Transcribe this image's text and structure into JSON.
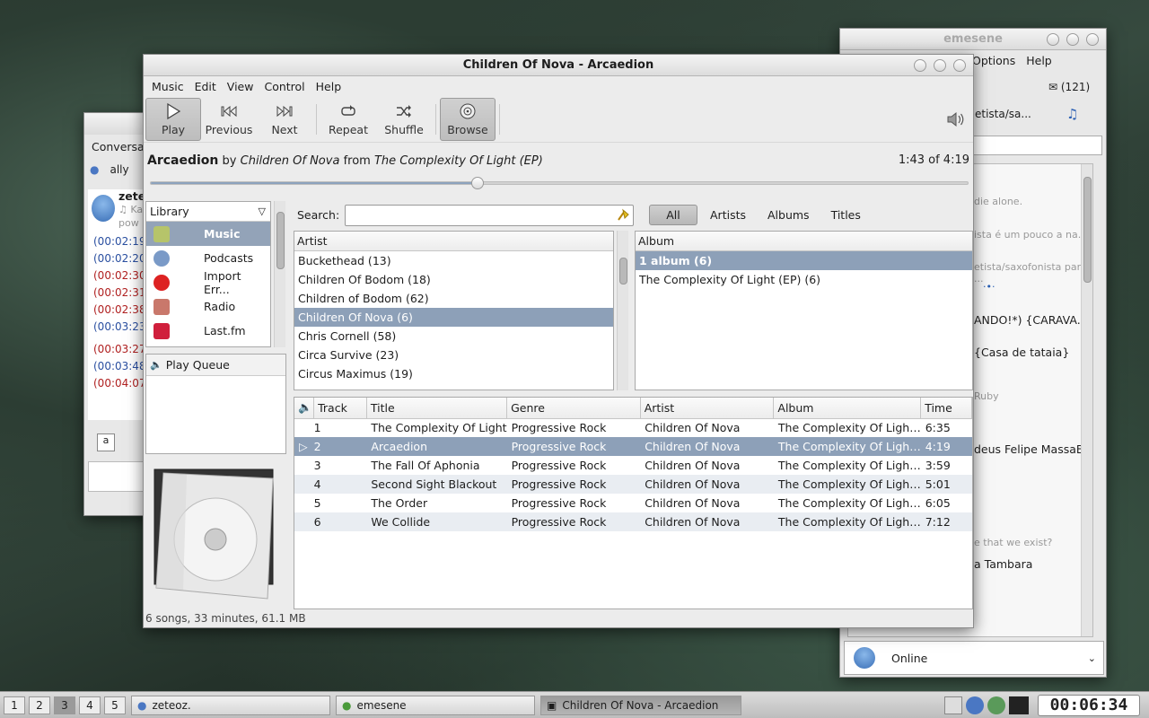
{
  "emesene": {
    "title": "emesene",
    "menu": [
      "Options",
      "Help"
    ],
    "mail_count": "(121)",
    "status": "Online",
    "lines": [
      "die alone.",
      "ista é um pouco a na...",
      "etista/saxofonista para ...",
      "·•·",
      "ANDO!*) {CARAVA...",
      "{Casa de tataia}",
      "Ruby",
      "deus Felipe MassaB",
      "e that we exist?",
      "a Tambara"
    ],
    "head_text": "etista/sa..."
  },
  "conversation": {
    "menu": "Conversa",
    "contact_short": "ally",
    "name": "zete",
    "sub1": "♫ Ka",
    "sub2": "pow",
    "times": [
      "(00:02:19",
      "(00:02:20",
      "(00:02:30",
      "(00:02:31",
      "(00:02:38",
      "(00:03:23",
      "(00:03:27",
      "(00:03:48",
      "(00:04:07"
    ]
  },
  "window": {
    "title": "Children Of Nova - Arcaedion"
  },
  "menu": {
    "music": "Music",
    "edit": "Edit",
    "view": "View",
    "control": "Control",
    "help": "Help"
  },
  "toolbar": {
    "play": "Play",
    "previous": "Previous",
    "next": "Next",
    "repeat": "Repeat",
    "shuffle": "Shuffle",
    "browse": "Browse"
  },
  "now_playing": {
    "track": "Arcaedion",
    "by": "by",
    "artist": "Children Of Nova",
    "from": "from",
    "album": "The Complexity Of Light (EP)",
    "time": "1:43 of 4:19",
    "progress": 0.4
  },
  "library": {
    "header": "Library",
    "items": [
      "Music",
      "Podcasts",
      "Import Err...",
      "Radio",
      "Last.fm"
    ]
  },
  "play_queue": "Play Queue",
  "search": {
    "label": "Search:",
    "value": ""
  },
  "filters": [
    "All",
    "Artists",
    "Albums",
    "Titles"
  ],
  "artist_header": "Artist",
  "artists": [
    "Buckethead (13)",
    "Children Of Bodom (18)",
    "Children of Bodom (62)",
    "Children Of Nova (6)",
    "Chris Cornell (58)",
    "Circa Survive (23)",
    "Circus Maximus (19)"
  ],
  "album_header": "Album",
  "albums": [
    "1 album (6)",
    "The Complexity Of Light (EP) (6)"
  ],
  "tracks": {
    "columns": [
      "Track",
      "Title",
      "Genre",
      "Artist",
      "Album",
      "Time"
    ],
    "rows": [
      [
        "1",
        "The Complexity Of Light",
        "Progressive Rock",
        "Children Of Nova",
        "The Complexity Of Ligh…",
        "6:35"
      ],
      [
        "2",
        "Arcaedion",
        "Progressive Rock",
        "Children Of Nova",
        "The Complexity Of Ligh…",
        "4:19"
      ],
      [
        "3",
        "The Fall Of Aphonia",
        "Progressive Rock",
        "Children Of Nova",
        "The Complexity Of Ligh…",
        "3:59"
      ],
      [
        "4",
        "Second Sight Blackout",
        "Progressive Rock",
        "Children Of Nova",
        "The Complexity Of Ligh…",
        "5:01"
      ],
      [
        "5",
        "The Order",
        "Progressive Rock",
        "Children Of Nova",
        "The Complexity Of Ligh…",
        "6:05"
      ],
      [
        "6",
        "We Collide",
        "Progressive Rock",
        "Children Of Nova",
        "The Complexity Of Ligh…",
        "7:12"
      ]
    ]
  },
  "statusbar": "6 songs, 33 minutes, 61.1 MB",
  "taskbar": {
    "workspaces": [
      "1",
      "2",
      "3",
      "4",
      "5"
    ],
    "tasks": [
      "zeteoz.",
      "emesene",
      "Children Of Nova - Arcaedion"
    ],
    "clock": "00:06:34"
  },
  "colors": {
    "selection": "#8da0b8",
    "accent": "#93a3b8"
  }
}
